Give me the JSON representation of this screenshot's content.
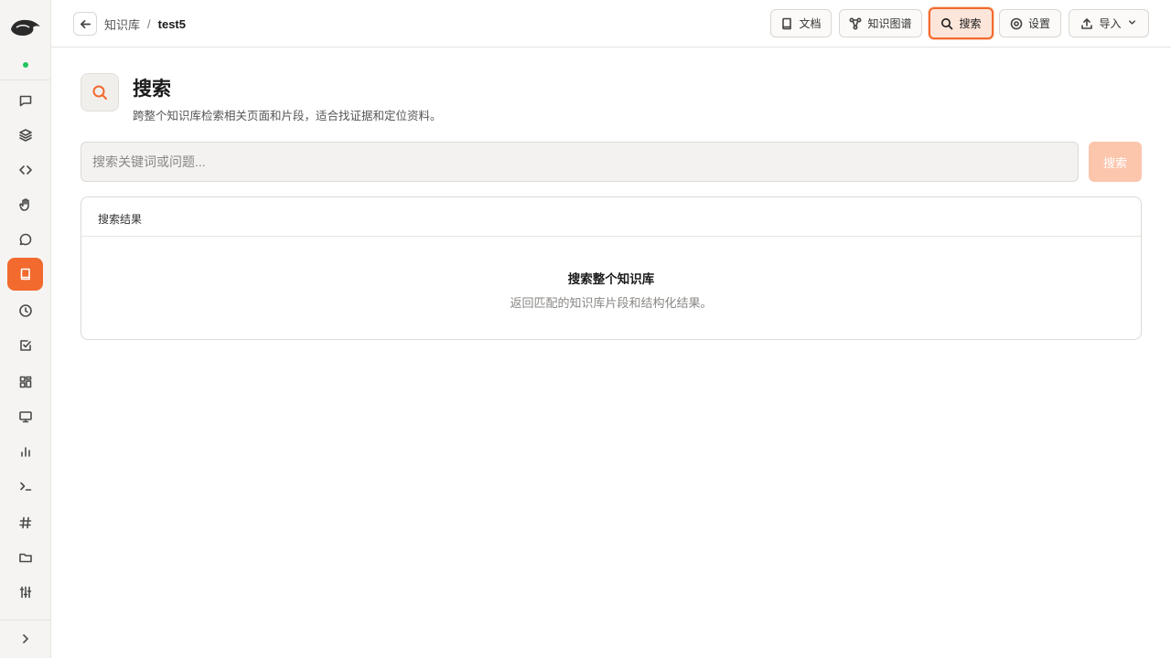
{
  "breadcrumb": {
    "parent": "知识库",
    "separator": "/",
    "current": "test5"
  },
  "toolbar": {
    "docs": "文档",
    "graph": "知识图谱",
    "search": "搜索",
    "settings": "设置",
    "import": "导入"
  },
  "page": {
    "title": "搜索",
    "subtitle": "跨整个知识库检索相关页面和片段，适合找证据和定位资料。"
  },
  "search": {
    "placeholder": "搜索关键词或问题...",
    "value": "",
    "button": "搜索"
  },
  "results": {
    "header": "搜索结果",
    "empty_title": "搜索整个知识库",
    "empty_desc": "返回匹配的知识库片段和结构化结果。"
  },
  "sidebar": {
    "items": [
      {
        "icon": "chat-icon"
      },
      {
        "icon": "layers-icon"
      },
      {
        "icon": "code-icon"
      },
      {
        "icon": "hand-icon"
      },
      {
        "icon": "message-icon"
      },
      {
        "icon": "book-icon",
        "active": true
      },
      {
        "icon": "clock-icon"
      },
      {
        "icon": "checkbox-icon"
      },
      {
        "icon": "grid-icon"
      },
      {
        "icon": "monitor-icon"
      },
      {
        "icon": "bar-chart-icon"
      },
      {
        "icon": "terminal-icon"
      },
      {
        "icon": "hash-icon",
        "glyph": "#"
      },
      {
        "icon": "folder-icon"
      },
      {
        "icon": "sliders-icon"
      }
    ],
    "status_color": "#22c55e"
  },
  "colors": {
    "accent": "#f26a2e",
    "accent_light": "#fcc6ad"
  }
}
